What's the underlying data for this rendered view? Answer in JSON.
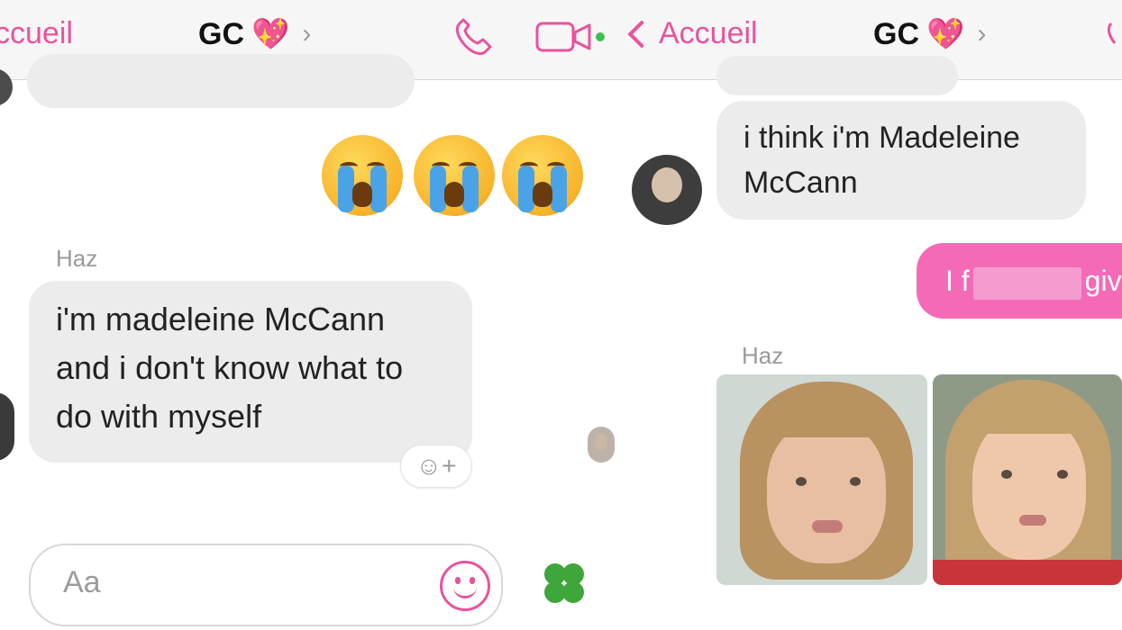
{
  "left": {
    "header": {
      "back_label": "ccueil",
      "title": "GC",
      "title_emoji": "💖",
      "chevron": "›"
    },
    "messages": {
      "sender": "Haz",
      "reply": "i'm madeleine McCann and i don't know what to do with myself"
    },
    "input_placeholder": "Aa",
    "react_label": "☺+"
  },
  "right": {
    "header": {
      "back_label": "Accueil",
      "title": "GC",
      "title_emoji": "💖",
      "chevron": "›"
    },
    "messages": {
      "incoming_text": "i think i'm Madeleine McCann",
      "outgoing_prefix": "I f",
      "outgoing_suffix": "giv",
      "sender": "Haz"
    }
  },
  "colors": {
    "accent": "#e8539c",
    "outgoing_bubble": "#f46ab7",
    "incoming_bubble": "#ececec"
  },
  "icons": [
    "phone-icon",
    "video-call-icon",
    "emoji-icon",
    "clover-icon",
    "back-chevron-icon"
  ]
}
